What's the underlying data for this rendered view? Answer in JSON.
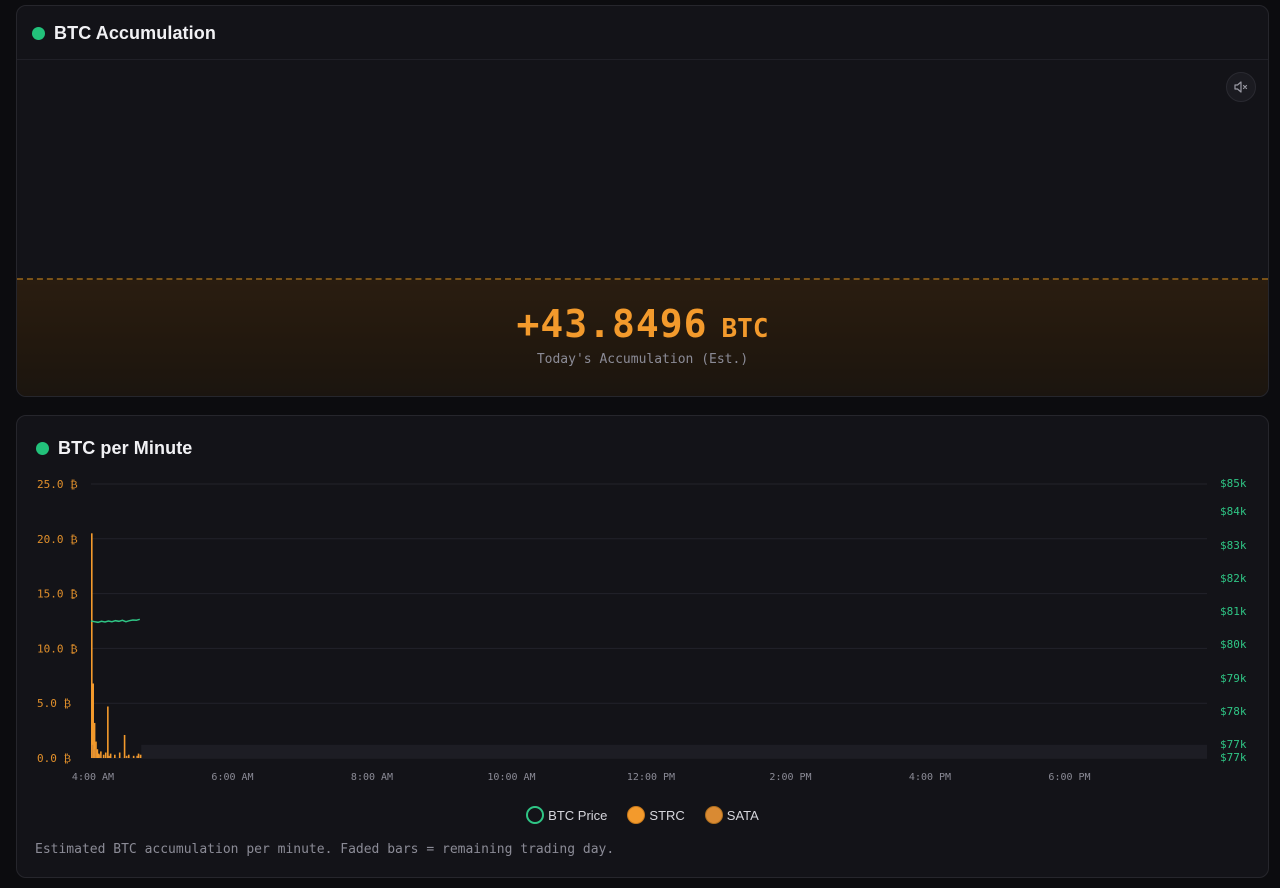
{
  "accumulation_card": {
    "title": "BTC Accumulation",
    "value": "+43.8496",
    "unit": "BTC",
    "caption": "Today's Accumulation (Est.)",
    "mute_icon": "speaker-muted-icon"
  },
  "minute_card": {
    "title": "BTC per Minute",
    "footnote": "Estimated BTC accumulation per minute. Faded bars = remaining trading day.",
    "legend": [
      {
        "label": "BTC Price",
        "color": "#2fc585",
        "style": "line"
      },
      {
        "label": "STRC",
        "color": "#f39a2c",
        "style": "bar"
      },
      {
        "label": "SATA",
        "color": "#d98a33",
        "style": "bar"
      }
    ]
  },
  "colors": {
    "accent_orange": "#f39a2c",
    "price_green": "#2fc585",
    "status_green": "#22c17a",
    "card_bg": "#131318"
  },
  "chart_data": {
    "type": "bar",
    "x_tick_labels": [
      "4:00 AM",
      "6:00 AM",
      "8:00 AM",
      "10:00 AM",
      "12:00 PM",
      "2:00 PM",
      "4:00 PM",
      "6:00 PM"
    ],
    "x_range_hours": [
      4,
      20
    ],
    "y_left_ticks": [
      "25.0 ₿",
      "20.0 ₿",
      "15.0 ₿",
      "10.0 ₿",
      "5.0 ₿",
      "0.0 ₿"
    ],
    "y_left_range": [
      0,
      25
    ],
    "y_right_ticks": [
      "$85k",
      "$84k",
      "$83k",
      "$82k",
      "$81k",
      "$80k",
      "$79k",
      "$78k",
      "$77k",
      "$77k"
    ],
    "y_right_range": [
      76800,
      85000
    ],
    "grid": true,
    "legend_position": "bottom-center",
    "series": [
      {
        "name": "STRC",
        "kind": "bar",
        "points": [
          [
            4.0,
            20.5
          ],
          [
            4.02,
            6.8
          ],
          [
            4.04,
            3.2
          ],
          [
            4.06,
            1.5
          ],
          [
            4.08,
            0.8
          ],
          [
            4.1,
            0.4
          ],
          [
            4.13,
            0.6
          ],
          [
            4.17,
            0.3
          ],
          [
            4.2,
            0.5
          ],
          [
            4.23,
            4.7
          ],
          [
            4.27,
            0.4
          ],
          [
            4.33,
            0.3
          ],
          [
            4.4,
            0.5
          ],
          [
            4.47,
            2.1
          ],
          [
            4.53,
            0.3
          ],
          [
            4.6,
            0.2
          ],
          [
            4.67,
            0.4
          ],
          [
            4.7,
            0.3
          ]
        ]
      },
      {
        "name": "SATA",
        "kind": "bar",
        "points": [
          [
            4.01,
            1.2
          ],
          [
            4.05,
            0.8
          ],
          [
            4.12,
            0.3
          ],
          [
            4.25,
            0.2
          ],
          [
            4.5,
            0.2
          ],
          [
            4.65,
            0.2
          ]
        ]
      },
      {
        "name": "BTC Price",
        "kind": "line",
        "points": [
          [
            4.0,
            80900
          ],
          [
            4.05,
            80880
          ],
          [
            4.1,
            80860
          ],
          [
            4.15,
            80890
          ],
          [
            4.2,
            80870
          ],
          [
            4.25,
            80900
          ],
          [
            4.3,
            80880
          ],
          [
            4.35,
            80910
          ],
          [
            4.4,
            80890
          ],
          [
            4.45,
            80920
          ],
          [
            4.5,
            80880
          ],
          [
            4.55,
            80910
          ],
          [
            4.6,
            80930
          ],
          [
            4.65,
            80920
          ],
          [
            4.7,
            80950
          ]
        ]
      }
    ],
    "remaining_day_start_hour": 4.72
  }
}
